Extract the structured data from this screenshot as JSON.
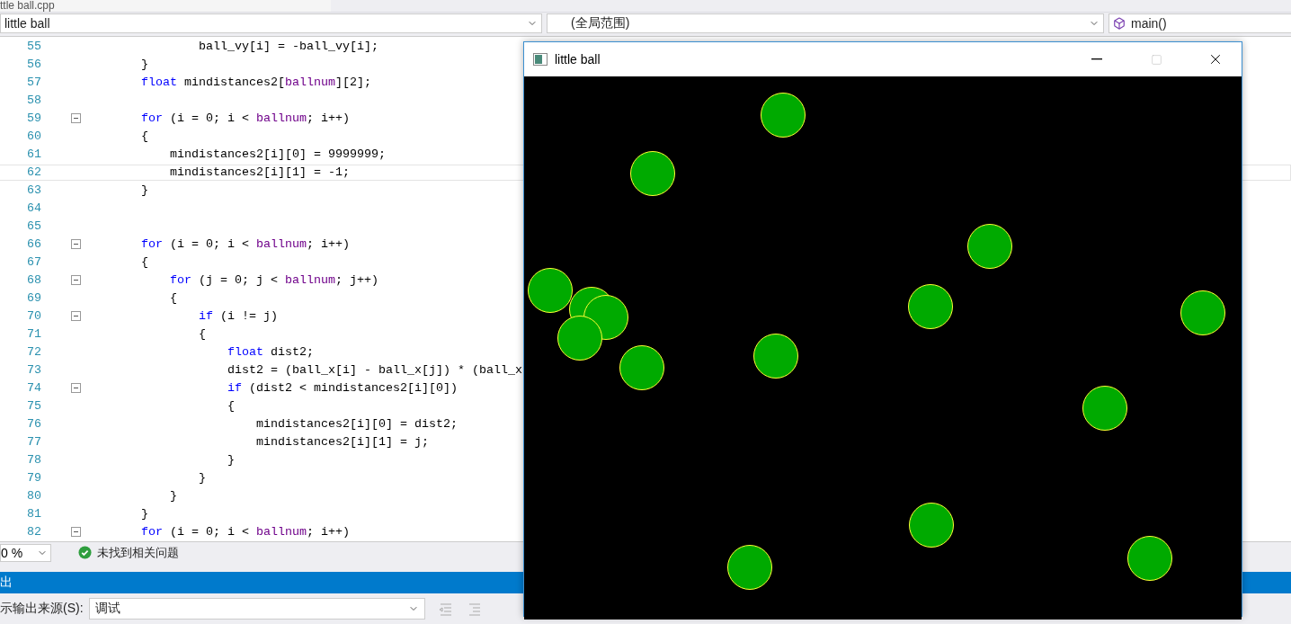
{
  "editor_tab": {
    "title": "ttle ball.cpp"
  },
  "nav_bar": {
    "project": "little ball",
    "scope": "(全局范围)",
    "member": "main()"
  },
  "code_lines": [
    {
      "number": "55",
      "fold": false,
      "current": false,
      "tokens": [
        {
          "kind": "plain",
          "t": "                ball_vy[i] = -ball_vy[i];"
        }
      ]
    },
    {
      "number": "56",
      "fold": false,
      "current": false,
      "tokens": [
        {
          "kind": "plain",
          "t": "        }"
        }
      ]
    },
    {
      "number": "57",
      "fold": false,
      "current": false,
      "tokens": [
        {
          "kind": "kw",
          "t": "        float"
        },
        {
          "kind": "plain",
          "t": " mindistances2["
        },
        {
          "kind": "macro",
          "t": "ballnum"
        },
        {
          "kind": "plain",
          "t": "][2];"
        }
      ]
    },
    {
      "number": "58",
      "fold": false,
      "current": false
    },
    {
      "number": "59",
      "fold": true,
      "current": false,
      "tokens": [
        {
          "kind": "kw",
          "t": "        for"
        },
        {
          "kind": "plain",
          "t": " (i = 0; i < "
        },
        {
          "kind": "macro",
          "t": "ballnum"
        },
        {
          "kind": "plain",
          "t": "; i++)"
        }
      ]
    },
    {
      "number": "60",
      "fold": false,
      "current": false,
      "tokens": [
        {
          "kind": "plain",
          "t": "        {"
        }
      ]
    },
    {
      "number": "61",
      "fold": false,
      "current": false,
      "tokens": [
        {
          "kind": "plain",
          "t": "            mindistances2[i][0] = 9999999;"
        }
      ]
    },
    {
      "number": "62",
      "fold": false,
      "current": true,
      "tokens": [
        {
          "kind": "plain",
          "t": "            mindistances2[i][1] = -1;"
        }
      ]
    },
    {
      "number": "63",
      "fold": false,
      "current": false,
      "tokens": [
        {
          "kind": "plain",
          "t": "        }"
        }
      ]
    },
    {
      "number": "64",
      "fold": false,
      "current": false
    },
    {
      "number": "65",
      "fold": false,
      "current": false
    },
    {
      "number": "66",
      "fold": true,
      "current": false,
      "tokens": [
        {
          "kind": "kw",
          "t": "        for"
        },
        {
          "kind": "plain",
          "t": " (i = 0; i < "
        },
        {
          "kind": "macro",
          "t": "ballnum"
        },
        {
          "kind": "plain",
          "t": "; i++)"
        }
      ]
    },
    {
      "number": "67",
      "fold": false,
      "current": false,
      "tokens": [
        {
          "kind": "plain",
          "t": "        {"
        }
      ]
    },
    {
      "number": "68",
      "fold": true,
      "current": false,
      "tokens": [
        {
          "kind": "kw",
          "t": "            for"
        },
        {
          "kind": "plain",
          "t": " (j = 0; j < "
        },
        {
          "kind": "macro",
          "t": "ballnum"
        },
        {
          "kind": "plain",
          "t": "; j++)"
        }
      ]
    },
    {
      "number": "69",
      "fold": false,
      "current": false,
      "tokens": [
        {
          "kind": "plain",
          "t": "            {"
        }
      ]
    },
    {
      "number": "70",
      "fold": true,
      "current": false,
      "tokens": [
        {
          "kind": "kw",
          "t": "                if"
        },
        {
          "kind": "plain",
          "t": " (i != j)"
        }
      ]
    },
    {
      "number": "71",
      "fold": false,
      "current": false,
      "tokens": [
        {
          "kind": "plain",
          "t": "                {"
        }
      ]
    },
    {
      "number": "72",
      "fold": false,
      "current": false,
      "tokens": [
        {
          "kind": "kw",
          "t": "                    float"
        },
        {
          "kind": "plain",
          "t": " dist2;"
        }
      ]
    },
    {
      "number": "73",
      "fold": false,
      "current": false,
      "tokens": [
        {
          "kind": "plain",
          "t": "                    dist2 = (ball_x[i] - ball_x[j]) * (ball_x"
        }
      ]
    },
    {
      "number": "74",
      "fold": true,
      "current": false,
      "tokens": [
        {
          "kind": "kw",
          "t": "                    if"
        },
        {
          "kind": "plain",
          "t": " (dist2 < mindistances2[i][0])"
        }
      ]
    },
    {
      "number": "75",
      "fold": false,
      "current": false,
      "tokens": [
        {
          "kind": "plain",
          "t": "                    {"
        }
      ]
    },
    {
      "number": "76",
      "fold": false,
      "current": false,
      "tokens": [
        {
          "kind": "plain",
          "t": "                        mindistances2[i][0] = dist2;"
        }
      ]
    },
    {
      "number": "77",
      "fold": false,
      "current": false,
      "tokens": [
        {
          "kind": "plain",
          "t": "                        mindistances2[i][1] = j;"
        }
      ]
    },
    {
      "number": "78",
      "fold": false,
      "current": false,
      "tokens": [
        {
          "kind": "plain",
          "t": "                    }"
        }
      ]
    },
    {
      "number": "79",
      "fold": false,
      "current": false,
      "tokens": [
        {
          "kind": "plain",
          "t": "                }"
        }
      ]
    },
    {
      "number": "80",
      "fold": false,
      "current": false,
      "tokens": [
        {
          "kind": "plain",
          "t": "            }"
        }
      ]
    },
    {
      "number": "81",
      "fold": false,
      "current": false,
      "tokens": [
        {
          "kind": "plain",
          "t": "        }"
        }
      ]
    },
    {
      "number": "82",
      "fold": true,
      "current": false,
      "tokens": [
        {
          "kind": "kw",
          "t": "        for"
        },
        {
          "kind": "plain",
          "t": " (i = 0; i < "
        },
        {
          "kind": "macro",
          "t": "ballnum"
        },
        {
          "kind": "plain",
          "t": "; i++)"
        }
      ]
    }
  ],
  "status_bar": {
    "zoom": "0 %",
    "issues": "未找到相关问题"
  },
  "output_panel": {
    "title": "出",
    "source_label": "示输出来源(S):",
    "source": "调试"
  },
  "app_window": {
    "title": "little ball"
  }
}
